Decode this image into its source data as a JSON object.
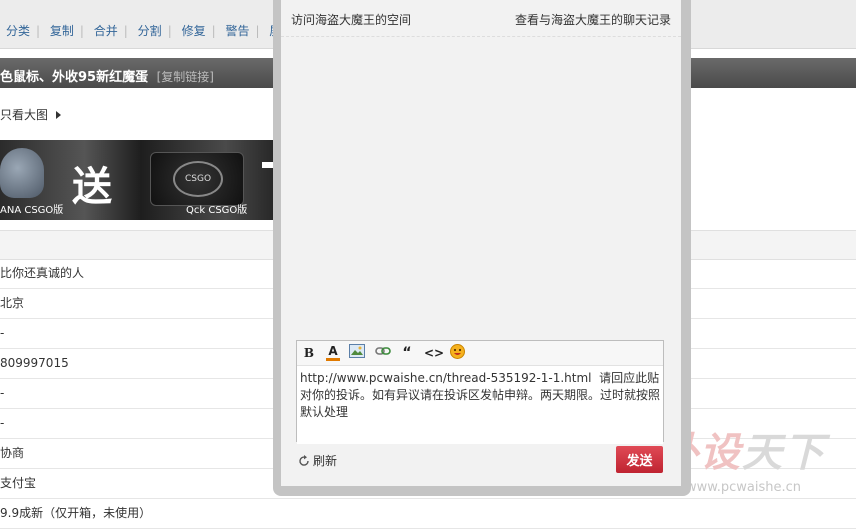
{
  "forum": {
    "toolbar_links": [
      "分类",
      "复制",
      "合并",
      "分割",
      "修复",
      "警告",
      "屏蔽"
    ],
    "thread_title": "色鼠标、外收95新红魔蛋",
    "copy_link": "[复制链接]",
    "view_big": "只看大图",
    "banner": {
      "text": "送",
      "caption_left": "ANA CSGO版",
      "caption_right": "Qck CSGO版",
      "pad_logo": "CSGO"
    },
    "rows": [
      "比你还真诚的人",
      "北京",
      "-",
      "809997015",
      "-",
      "-",
      "协商",
      "支付宝",
      "9.9成新（仅开箱，未使用）"
    ]
  },
  "dialog": {
    "visit_space": "访问海盗大魔王的空间",
    "chat_history": "查看与海盗大魔王的聊天记录",
    "editor_tools": [
      "B",
      "A",
      "image-icon",
      "link-icon",
      "“",
      "<>",
      "smiley-icon"
    ],
    "message": "http://www.pcwaishe.cn/thread-535192-1-1.html  请回应此贴对你的投诉。如有异议请在投诉区发帖申辩。两天期限。过时就按照默认处理",
    "refresh_label": "刷新",
    "send_label": "发送",
    "send_color": "#c8303b"
  },
  "watermark": {
    "title_1": "外设",
    "title_2": "天下",
    "url": "www.pcwaishe.cn"
  }
}
